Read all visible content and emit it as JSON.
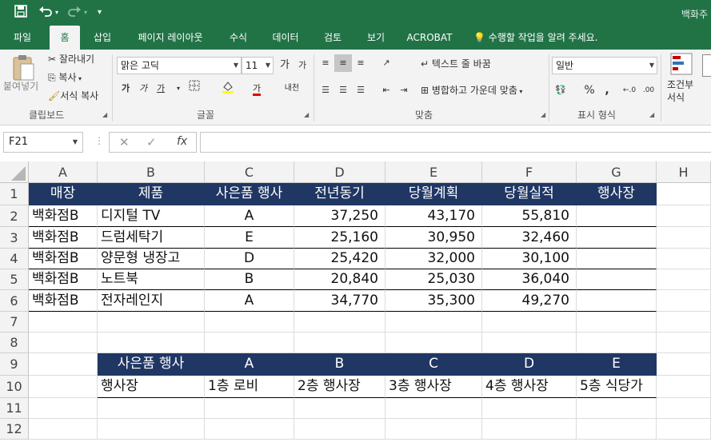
{
  "titlebar": {
    "save_icon": "save-icon",
    "undo_icon": "undo-icon",
    "redo_icon": "redo-icon",
    "customize_icon": "chevron-down-icon",
    "filename": "백화주"
  },
  "tabs": [
    {
      "label": "파일",
      "active": false
    },
    {
      "label": "홈",
      "active": true
    },
    {
      "label": "삽입",
      "active": false
    },
    {
      "label": "페이지 레이아웃",
      "active": false
    },
    {
      "label": "수식",
      "active": false
    },
    {
      "label": "데이터",
      "active": false
    },
    {
      "label": "검토",
      "active": false
    },
    {
      "label": "보기",
      "active": false
    },
    {
      "label": "ACROBAT",
      "active": false
    }
  ],
  "tell_me": "수행할 작업을 알려 주세요.",
  "ribbon": {
    "clipboard": {
      "paste": "붙여넣기",
      "cut": "잘라내기",
      "copy": "복사",
      "format_painter": "서식 복사",
      "group_label": "클립보드"
    },
    "font": {
      "name": "맑은 고딕",
      "size": "11",
      "grow": "가",
      "shrink": "가",
      "bold": "가",
      "italic": "가",
      "underline": "가",
      "font_color_glyph": "가",
      "phonetic": "내천",
      "group_label": "글꼴"
    },
    "alignment": {
      "wrap_text": "텍스트 줄 바꿈",
      "merge_center": "병합하고 가운데 맞춤",
      "group_label": "맞춤"
    },
    "number": {
      "format": "일반",
      "percent": "%",
      "comma": ",",
      "group_label": "표시 형식"
    },
    "styles": {
      "conditional_format": "조건부 서식"
    },
    "accent_color": "#217346"
  },
  "formula_bar": {
    "name_box": "F21",
    "cancel_glyph": "✕",
    "enter_glyph": "✓",
    "fx_glyph": "fx",
    "formula": ""
  },
  "sheet": {
    "columns": [
      "A",
      "B",
      "C",
      "D",
      "E",
      "F",
      "G",
      "H"
    ],
    "rows": [
      "1",
      "2",
      "3",
      "4",
      "5",
      "6",
      "7",
      "8",
      "9",
      "10",
      "11",
      "12"
    ],
    "header_color": "#203764",
    "table1": {
      "headers": [
        "매장",
        "제품",
        "사은품 행사",
        "전년동기",
        "당월계획",
        "당월실적",
        "행사장"
      ],
      "rows": [
        [
          "백화점B",
          "디지털 TV",
          "A",
          "37,250",
          "43,170",
          "55,810",
          ""
        ],
        [
          "백화점B",
          "드럼세탁기",
          "E",
          "25,160",
          "30,950",
          "32,460",
          ""
        ],
        [
          "백화점B",
          "양문형 냉장고",
          "D",
          "25,420",
          "32,000",
          "30,100",
          ""
        ],
        [
          "백화점B",
          "노트북",
          "B",
          "20,840",
          "25,030",
          "36,040",
          ""
        ],
        [
          "백화점B",
          "전자레인지",
          "A",
          "34,770",
          "35,300",
          "49,270",
          ""
        ]
      ]
    },
    "table2": {
      "headers": [
        "사은품 행사",
        "A",
        "B",
        "C",
        "D",
        "E"
      ],
      "row": [
        "행사장",
        "1층 로비",
        "2층 행사장",
        "3층 행사장",
        "4층 행사장",
        "5층 식당가"
      ]
    }
  }
}
